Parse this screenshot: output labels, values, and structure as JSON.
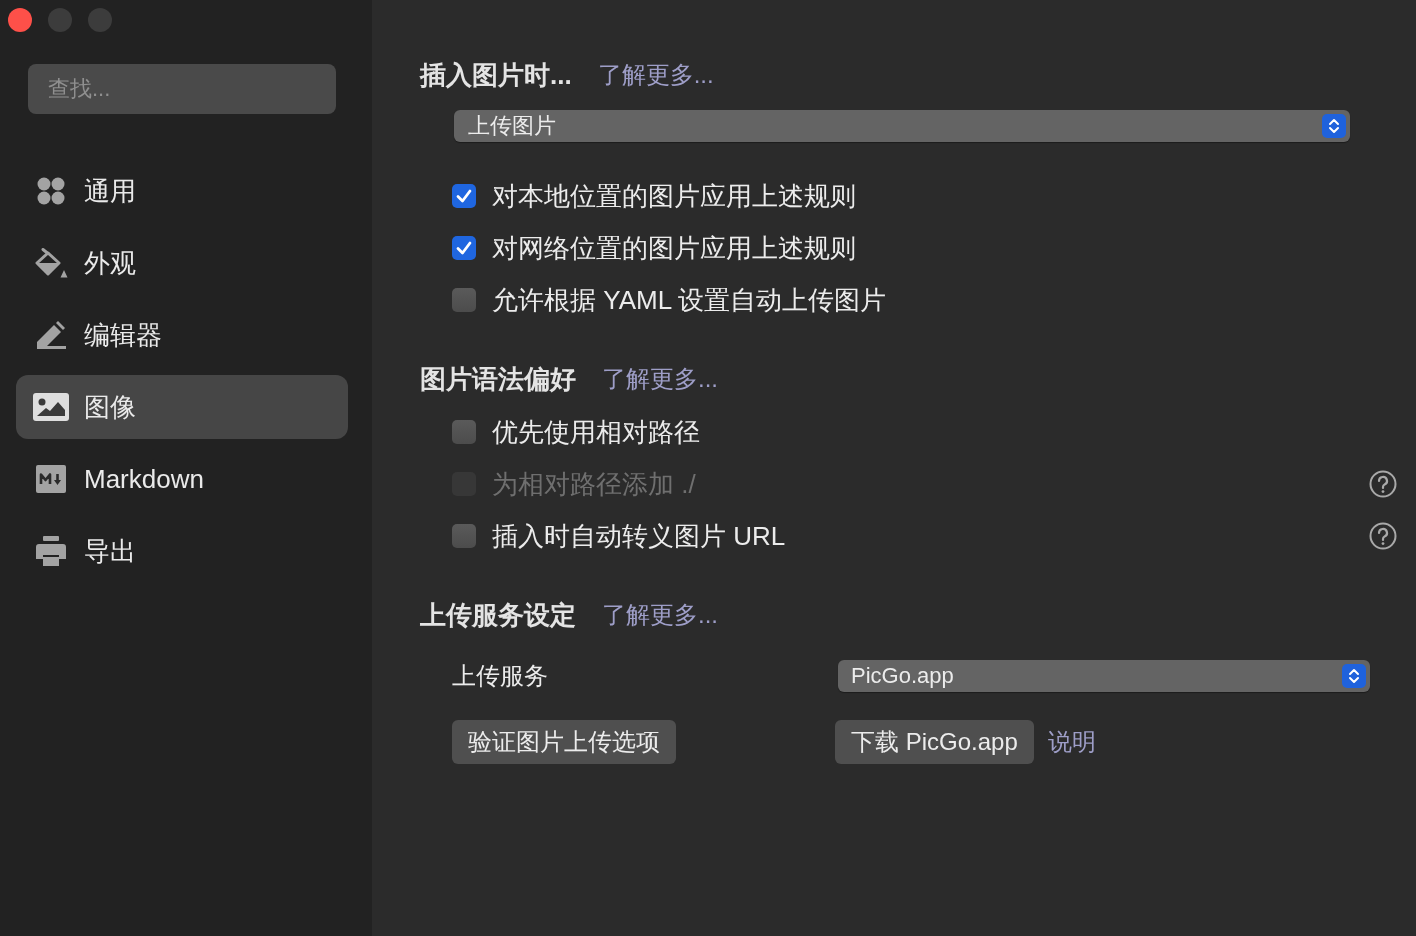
{
  "window": {
    "controls": [
      {
        "color": "#fe5049"
      },
      {
        "color": "#3c3c3c"
      },
      {
        "color": "#3c3c3c"
      }
    ]
  },
  "sidebar": {
    "search": {
      "placeholder": "查找..."
    },
    "items": [
      {
        "label": "通用",
        "selected": false
      },
      {
        "label": "外观",
        "selected": false
      },
      {
        "label": "编辑器",
        "selected": false
      },
      {
        "label": "图像",
        "selected": true
      },
      {
        "label": "Markdown",
        "selected": false
      },
      {
        "label": "导出",
        "selected": false
      }
    ]
  },
  "sections": [
    {
      "title": "插入图片时...",
      "link": "了解更多...",
      "dropdown": {
        "value": "上传图片"
      },
      "options": [
        {
          "label": "对本地位置的图片应用上述规则",
          "checked": true,
          "disabled": false,
          "help": false
        },
        {
          "label": "对网络位置的图片应用上述规则",
          "checked": true,
          "disabled": false,
          "help": false
        },
        {
          "label": "允许根据 YAML 设置自动上传图片",
          "checked": false,
          "disabled": false,
          "help": false
        }
      ]
    },
    {
      "title": "图片语法偏好",
      "link": "了解更多...",
      "options": [
        {
          "label": "优先使用相对路径",
          "checked": false,
          "disabled": false,
          "help": false
        },
        {
          "label": "为相对路径添加 ./",
          "checked": false,
          "disabled": true,
          "help": true
        },
        {
          "label": "插入时自动转义图片 URL",
          "checked": false,
          "disabled": false,
          "help": true
        }
      ]
    },
    {
      "title": "上传服务设定",
      "link": "了解更多...",
      "service": {
        "label": "上传服务",
        "dropdown": {
          "value": "PicGo.app"
        },
        "verify_button": "验证图片上传选项",
        "download_button": "下载 PicGo.app",
        "help_link": "说明"
      }
    }
  ]
}
